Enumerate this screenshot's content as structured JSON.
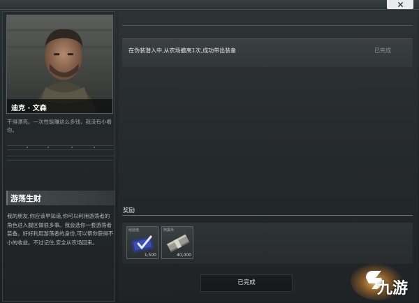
{
  "character": {
    "name": "迪克 · 文森",
    "quote": "干得漂亮。一次性能赚这么多钱，我没有小看你。"
  },
  "mission": {
    "title": "游荡生财",
    "description": "我的朋友,你应该早知道,你可以利用游荡者的角色进入服区做很多事。我会选你一套游荡者装备。好好利用游荡者的身份,可以帮你获得不小的收益。不过记住,安全从农场回来。"
  },
  "objective": {
    "text": "在伪装潜入中,从农场撤离1次,成功带出装备",
    "status": "已完成"
  },
  "rewards": {
    "label": "奖励",
    "items": [
      {
        "name": "经验值",
        "count": "1,500",
        "icon": "exp-card-icon"
      },
      {
        "name": "阿黑币",
        "count": "40,000",
        "icon": "cash-stack-icon"
      }
    ]
  },
  "buttons": {
    "complete": "已完成"
  },
  "watermark": {
    "text": "九游"
  },
  "colors": {
    "accent": "#e07b2a",
    "panel": "#23282a"
  }
}
